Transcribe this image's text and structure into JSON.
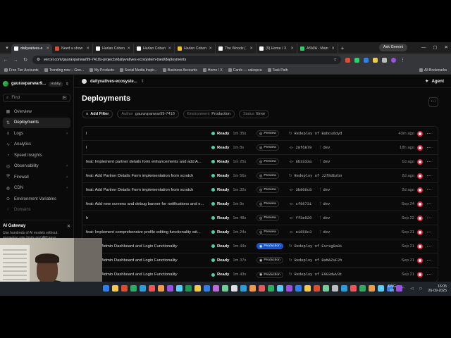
{
  "browser": {
    "tabs": [
      {
        "label": "dailyvatives-e",
        "color": "#ffffff",
        "active": true
      },
      {
        "label": "Need a show",
        "color": "#e34b2e"
      },
      {
        "label": "Harlan Coben",
        "color": "#ffffff"
      },
      {
        "label": "Harlan Coben",
        "color": "#ffffff"
      },
      {
        "label": "Harlan Coben",
        "color": "#f5c518"
      },
      {
        "label": "The Woods (",
        "color": "#ffffff"
      },
      {
        "label": "(9) Home / X",
        "color": "#ffffff"
      },
      {
        "label": "ASWA - Main",
        "color": "#25d366"
      }
    ],
    "gemini_label": "Ask Gemini",
    "url": "vercel.com/gauravpanwar99-7418s-projects/dailyvatives-ecosystem-tned/deployments",
    "bookmarks": [
      "Free Tier Accounts",
      "Trending now – Goo...",
      "My Products",
      "Social Media Inspir...",
      "Business Accounts",
      "Home / X",
      "Cards — salespca",
      "Task Path"
    ],
    "all_bookmarks": "All Bookmarks"
  },
  "sidebar": {
    "team_name": "gauravpanwar9...",
    "plan": "Hobby",
    "find_placeholder": "Find",
    "find_shortcut": "F",
    "items": [
      {
        "label": "Overview",
        "icon": "grid-icon",
        "glyph": "▦"
      },
      {
        "label": "Deployments",
        "icon": "deployments-icon",
        "glyph": "⇅",
        "active": true
      },
      {
        "label": "Logs",
        "icon": "logs-icon",
        "glyph": "≡",
        "chevron": true
      },
      {
        "label": "Analytics",
        "icon": "analytics-icon",
        "glyph": "∿"
      },
      {
        "label": "Speed Insights",
        "icon": "speed-icon",
        "glyph": "◔"
      },
      {
        "label": "Observability",
        "icon": "observability-icon",
        "glyph": "◎",
        "chevron": true
      },
      {
        "label": "Firewall",
        "icon": "firewall-icon",
        "glyph": "⛨",
        "chevron": true
      },
      {
        "label": "CDN",
        "icon": "globe-icon",
        "glyph": "◍",
        "chevron": true
      },
      {
        "label": "Environment Variables",
        "icon": "env-icon",
        "glyph": "⊙"
      },
      {
        "label": "Domains",
        "icon": "domains-icon",
        "glyph": "◌",
        "dim": true
      }
    ],
    "gateway_title": "AI Gateway",
    "gateway_body": "Use hundreds of AI models without managing rate limits and API keys."
  },
  "topbar": {
    "project": "dailyvatives-ecosyste...",
    "agent_label": "Agent"
  },
  "main": {
    "title": "Deployments",
    "add_filter": "Add Filter",
    "filters": [
      {
        "key": "Author",
        "value": "gauravpanwar99-7418"
      },
      {
        "key": "Environment",
        "value": "Production"
      },
      {
        "key": "Status",
        "value": "Error"
      }
    ],
    "rows": [
      {
        "msg": "l",
        "status": "Ready",
        "dur": "1m 35s",
        "env": "Preview",
        "src_icon": "↻",
        "src": "Redeploy of Babcu6dyd",
        "branch": "",
        "time": "43m ago"
      },
      {
        "msg": "l",
        "status": "Ready",
        "dur": "1m 8s",
        "env": "Preview",
        "src_icon": "-o-",
        "src": "28f6879",
        "branch": "dev",
        "time": "18h ago"
      },
      {
        "msg": "feat: Implement partner details form enhancements and add A...",
        "status": "Ready",
        "dur": "1m 25s",
        "env": "Preview",
        "src_icon": "-o-",
        "src": "6b3333a",
        "branch": "dev",
        "time": "1d ago"
      },
      {
        "msg": "feat: Add Partner Details Form implementation from scratch",
        "status": "Ready",
        "dur": "1m 56s",
        "env": "Preview",
        "src_icon": "↻",
        "src": "Redeploy of J2f8dbzbn",
        "branch": "",
        "time": "2d ago"
      },
      {
        "msg": "feat: Add Partner Details Form implementation from scratch",
        "status": "Ready",
        "dur": "1m 32s",
        "env": "Preview",
        "src_icon": "-o-",
        "src": "3b806c8",
        "branch": "dev",
        "time": "2d ago"
      },
      {
        "msg": "feat: Add new screens and debug banner for notifications and e...",
        "status": "Ready",
        "dur": "1m 9s",
        "env": "Preview",
        "src_icon": "-o-",
        "src": "cf96731",
        "branch": "dev",
        "time": "Sep 24"
      },
      {
        "msg": "h",
        "status": "Ready",
        "dur": "1m 48s",
        "env": "Preview",
        "src_icon": "-o-",
        "src": "ff3e529",
        "branch": "dev",
        "time": "Sep 22"
      },
      {
        "msg": "feat: Implement comprehensive profile editing functionality wit...",
        "status": "Ready",
        "dur": "1m 24s",
        "env": "Preview",
        "src_icon": "-o-",
        "src": "e1659c3",
        "branch": "dev",
        "time": "Sep 21"
      },
      {
        "msg": "plement Admin Dashboard and Login Functionality",
        "status": "Ready",
        "dur": "1m 44s",
        "env": "Production",
        "env_current": true,
        "src_icon": "↻",
        "src": "Redeploy of Evrsg8a8i",
        "branch": "",
        "time": "Sep 21"
      },
      {
        "msg": "plement Admin Dashboard and Login Functionality",
        "status": "Ready",
        "dur": "1m 37s",
        "env": "Production",
        "src_icon": "↻",
        "src": "Redeploy of BaMAZuF2h",
        "branch": "",
        "time": "Sep 21"
      },
      {
        "msg": "plement Admin Dashboard and Login Functionality",
        "status": "Ready",
        "dur": "1m 43s",
        "env": "Production",
        "src_icon": "↻",
        "src": "Redeploy of E9G3dwV3t",
        "branch": "",
        "time": "Sep 21"
      }
    ]
  },
  "taskbar": {
    "lang_top": "ENG",
    "lang_bottom": "IN",
    "time": "16:05",
    "date": "26-09-2025",
    "icon_colors": [
      "#2f80ed",
      "#f2c94c",
      "#e34b2e",
      "#27ae60",
      "#2d9cdb",
      "#eb5757",
      "#f2994a",
      "#9b51e0",
      "#56ccf2",
      "#219653",
      "#f2c94c",
      "#2f80ed",
      "#bb6bd9",
      "#6fcf97",
      "#e0e0e0",
      "#2d9cdb",
      "#f2994a",
      "#eb5757",
      "#27ae60",
      "#56ccf2",
      "#9b51e0",
      "#2f80ed",
      "#f2c94c",
      "#e34b2e",
      "#6fcf97",
      "#bdbdbd",
      "#2d9cdb",
      "#eb5757",
      "#27ae60",
      "#f2994a",
      "#56ccf2",
      "#2f80ed",
      "#9b51e0"
    ]
  }
}
